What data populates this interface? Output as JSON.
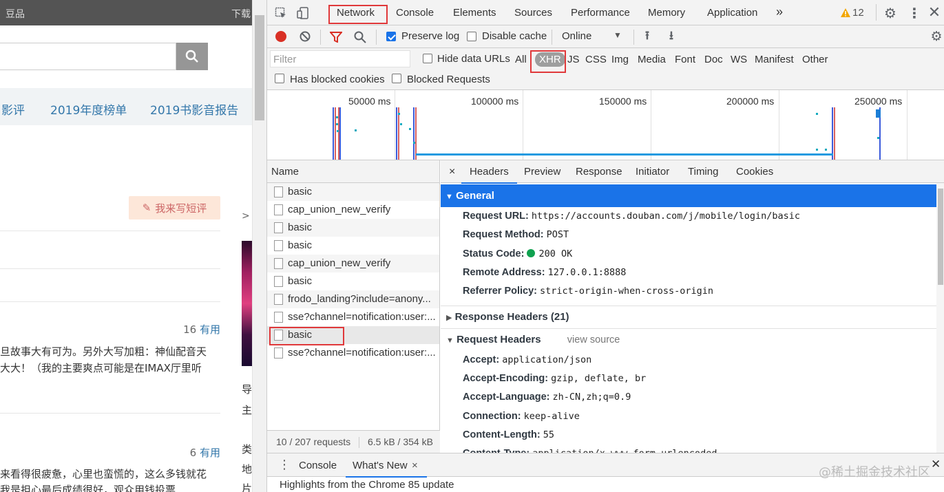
{
  "page": {
    "topbar_left": "豆品",
    "topbar_right": "下载",
    "nav": [
      "影评",
      "2019年度榜单",
      "2019书影音报告"
    ],
    "write_button": "我来写短评",
    "more_arrow": ">",
    "review1_useful_count": "16",
    "review1_useful_label": "有用",
    "review1_line1": "旦故事大有可为。另外大写加粗：神仙配音天",
    "review1_line2": "大大！（我的主要爽点可能是在IMAX厅里听",
    "review2_useful_count": "6",
    "review2_useful_label": "有用",
    "review2_line1": "来看得很疲惫，心里也蛮慌的，这么多钱就花",
    "review2_line2": "我是担心最后成绩很好，观众用钱投票",
    "side_chars": [
      "导",
      "主",
      "类",
      "地",
      "片"
    ]
  },
  "devtools": {
    "tabs": [
      "Network",
      "Console",
      "Elements",
      "Sources",
      "Performance",
      "Memory",
      "Application"
    ],
    "more_tabs": "»",
    "warning_count": "12",
    "toolbar": {
      "preserve_log": "Preserve log",
      "disable_cache": "Disable cache",
      "throttle": "Online"
    },
    "filter": {
      "placeholder": "Filter",
      "hide_data_urls": "Hide data URLs",
      "types": [
        "All",
        "XHR",
        "JS",
        "CSS",
        "Img",
        "Media",
        "Font",
        "Doc",
        "WS",
        "Manifest",
        "Other"
      ],
      "selected_type": "XHR",
      "has_blocked_cookies": "Has blocked cookies",
      "blocked_requests": "Blocked Requests"
    },
    "timeline_ticks": [
      "50000 ms",
      "100000 ms",
      "150000 ms",
      "200000 ms",
      "250000 ms"
    ],
    "list": {
      "header": "Name",
      "items": [
        "basic",
        "cap_union_new_verify",
        "basic",
        "basic",
        "cap_union_new_verify",
        "basic",
        "frodo_landing?include=anony...",
        "sse?channel=notification:user:...",
        "basic",
        "sse?channel=notification:user:..."
      ],
      "selected_index": 8,
      "status": "10 / 207 requests",
      "size": "6.5 kB / 354 kB"
    },
    "detail": {
      "close": "×",
      "tabs": [
        "Headers",
        "Preview",
        "Response",
        "Initiator",
        "Timing",
        "Cookies"
      ],
      "general_title": "General",
      "general": [
        {
          "k": "Request URL:",
          "v": "https://accounts.douban.com/j/mobile/login/basic"
        },
        {
          "k": "Request Method:",
          "v": "POST"
        },
        {
          "k": "Status Code:",
          "v": "200 OK"
        },
        {
          "k": "Remote Address:",
          "v": "127.0.0.1:8888"
        },
        {
          "k": "Referrer Policy:",
          "v": "strict-origin-when-cross-origin"
        }
      ],
      "response_headers": "Response Headers (21)",
      "request_headers": "Request Headers",
      "view_source": "view source",
      "req": [
        {
          "k": "Accept:",
          "v": "application/json"
        },
        {
          "k": "Accept-Encoding:",
          "v": "gzip, deflate, br"
        },
        {
          "k": "Accept-Language:",
          "v": "zh-CN,zh;q=0.9"
        },
        {
          "k": "Connection:",
          "v": "keep-alive"
        },
        {
          "k": "Content-Length:",
          "v": "55"
        },
        {
          "k": "Content-Type:",
          "v": "application/x-www-form-urlencoded"
        }
      ]
    },
    "drawer": {
      "tabs": [
        "Console",
        "What's New"
      ],
      "close_tab": "×",
      "message": "Highlights from the Chrome 85 update"
    },
    "watermark": "@稀土掘金技术社区",
    "colors": {
      "accent": "#1a73e8",
      "record": "#d93025",
      "highlight_box": "#e0383a",
      "status_ok": "#0fa14f"
    }
  }
}
